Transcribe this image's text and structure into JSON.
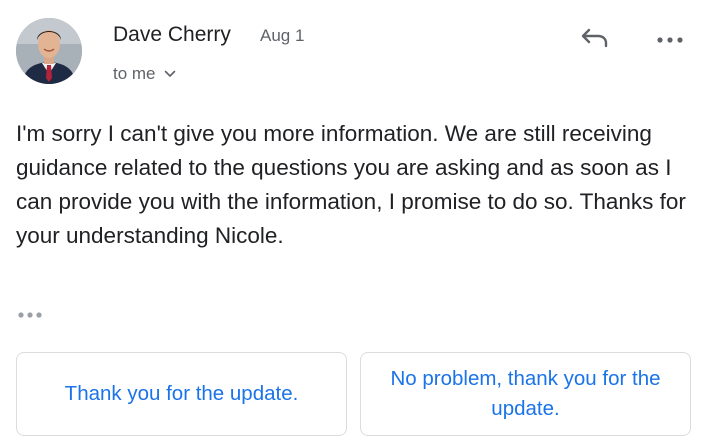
{
  "email": {
    "sender": {
      "name": "Dave Cherry",
      "date": "Aug 1"
    },
    "recipient_label": "to me",
    "body": "I'm sorry I can't give you more information. We are still receiving guidance related to the questions you are asking and as soon as I can provide you with the information, I promise to do so. Thanks for your understanding Nicole."
  },
  "icons": {
    "reply": "reply-arrow-icon",
    "more": "more-horizontal-icon",
    "expand": "chevron-down-icon",
    "trimmed": "ellipsis-icon"
  },
  "smart_replies": [
    {
      "label": "Thank you for the update."
    },
    {
      "label": "No problem, thank you for the update."
    }
  ],
  "colors": {
    "text": "#202124",
    "secondary_text": "#5f6368",
    "accent": "#1a73e8",
    "border": "#dadce0"
  }
}
